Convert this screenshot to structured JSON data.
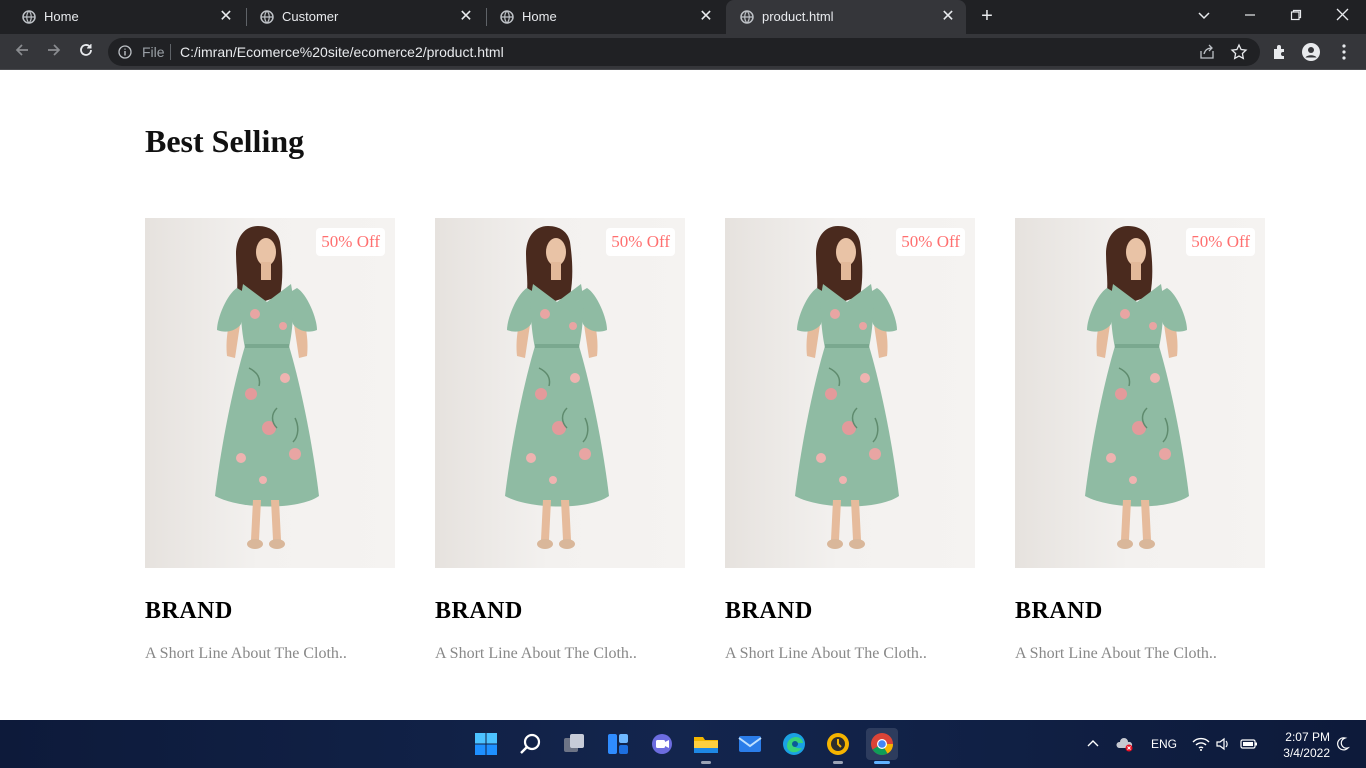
{
  "browser": {
    "tabs": [
      {
        "title": "Home",
        "active": false
      },
      {
        "title": "Customer",
        "active": false
      },
      {
        "title": "Home",
        "active": false
      },
      {
        "title": "product.html",
        "active": true
      }
    ],
    "omnibox": {
      "scheme_label": "File",
      "url": "C:/imran/Ecomerce%20site/ecomerce2/product.html"
    }
  },
  "page": {
    "section_title": "Best Selling",
    "products": [
      {
        "badge": "50% Off",
        "brand": "BRAND",
        "description": "A Short Line About The Cloth.."
      },
      {
        "badge": "50% Off",
        "brand": "BRAND",
        "description": "A Short Line About The Cloth.."
      },
      {
        "badge": "50% Off",
        "brand": "BRAND",
        "description": "A Short Line About The Cloth.."
      },
      {
        "badge": "50% Off",
        "brand": "BRAND",
        "description": "A Short Line About The Cloth.."
      }
    ]
  },
  "taskbar": {
    "language": "ENG",
    "time": "2:07 PM",
    "date": "3/4/2022"
  },
  "colors": {
    "badge_text": "#ff6f6f",
    "dress": "#8fbba3",
    "active_indicator": "#5fb2ff"
  }
}
